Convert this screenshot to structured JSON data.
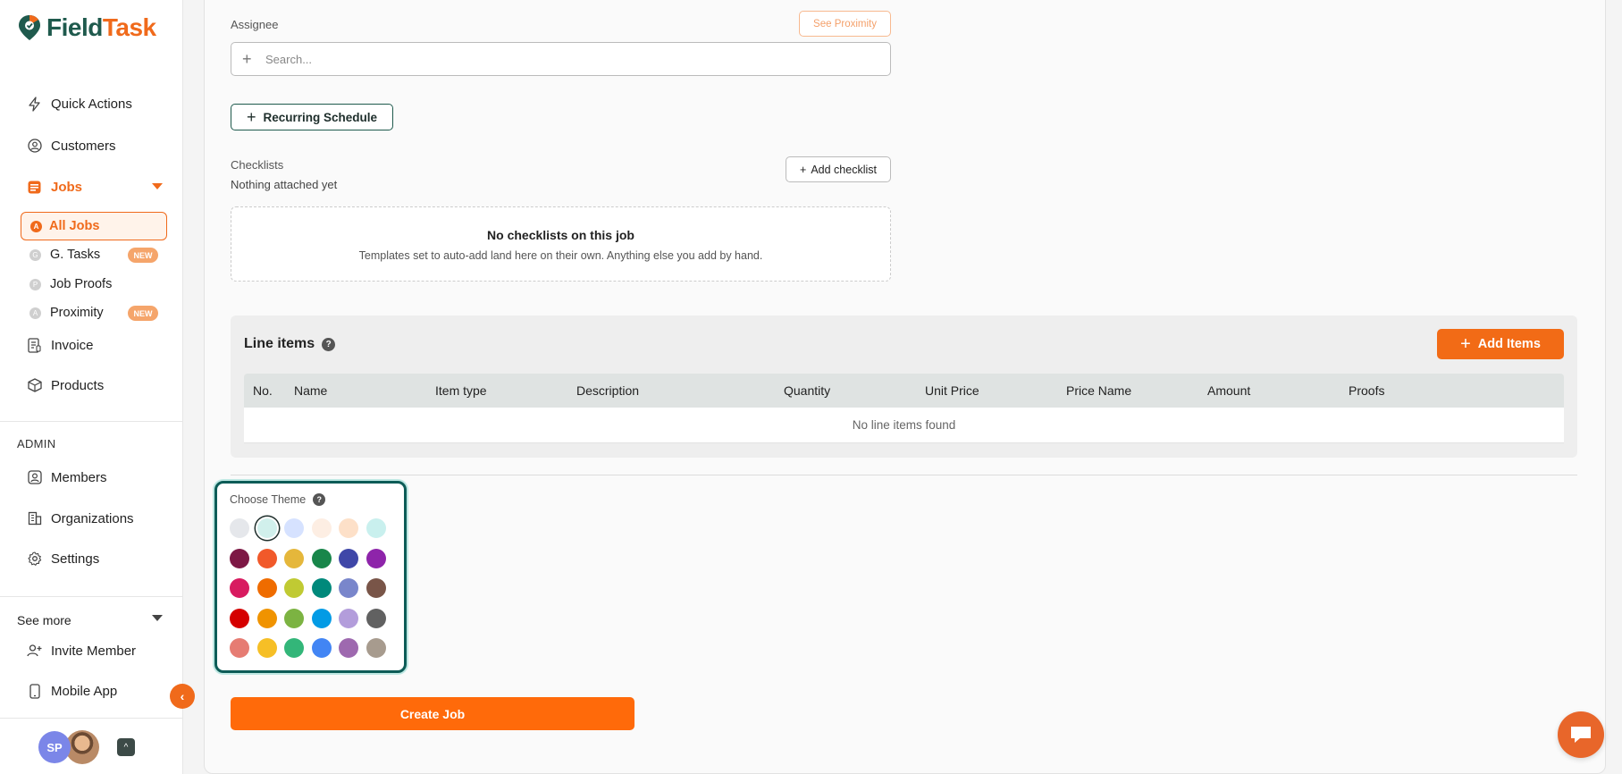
{
  "brand": {
    "name_part1": "Field",
    "name_part2": "Task"
  },
  "sidebar": {
    "items": [
      {
        "label": "Quick Actions",
        "icon": "lightning-icon"
      },
      {
        "label": "Customers",
        "icon": "user-circle-icon"
      },
      {
        "label": "Jobs",
        "icon": "jobs-icon"
      },
      {
        "label": "Invoice",
        "icon": "invoice-icon"
      },
      {
        "label": "Products",
        "icon": "box-icon"
      }
    ],
    "jobs_sub": [
      {
        "label": "All Jobs",
        "letter": "A"
      },
      {
        "label": "G. Tasks",
        "letter": "G",
        "badge": "NEW"
      },
      {
        "label": "Job Proofs",
        "letter": "P"
      },
      {
        "label": "Proximity",
        "letter": "A",
        "badge": "NEW"
      }
    ],
    "admin_label": "ADMIN",
    "admin_items": [
      {
        "label": "Members",
        "icon": "member-icon"
      },
      {
        "label": "Organizations",
        "icon": "building-icon"
      },
      {
        "label": "Settings",
        "icon": "gear-icon"
      }
    ],
    "see_more": "See more",
    "more_items": [
      {
        "label": "Invite Member",
        "icon": "user-plus-icon"
      },
      {
        "label": "Mobile App",
        "icon": "phone-icon"
      }
    ],
    "user_initials": "SP",
    "collapse_glyph": "‹",
    "user_menu_glyph": "^"
  },
  "form": {
    "assignee_label": "Assignee",
    "see_proximity": "See Proximity",
    "search_placeholder": "Search...",
    "recurring_label": "Recurring Schedule",
    "checklists_label": "Checklists",
    "checklists_sub": "Nothing attached yet",
    "add_checklist": "Add checklist",
    "no_checklists_title": "No checklists on this job",
    "no_checklists_desc": "Templates set to auto-add land here on their own. Anything else you add by hand.",
    "line_items_title": "Line items",
    "add_items": "Add Items",
    "columns": [
      "No.",
      "Name",
      "Item type",
      "Description",
      "Quantity",
      "Unit Price",
      "Price Name",
      "Amount",
      "Proofs"
    ],
    "no_line_items": "No line items found",
    "theme_label": "Choose Theme",
    "create_job": "Create Job"
  },
  "theme_colors": [
    [
      "#e5e7eb",
      "#d1f0ec",
      "#d6e2ff",
      "#fdeee3",
      "#fde0c8",
      "#c9f0ee"
    ],
    [
      "#7d1845",
      "#f1592a",
      "#e5b73b",
      "#18864a",
      "#3f47a8",
      "#8e24aa"
    ],
    [
      "#d81b60",
      "#ef6c00",
      "#c0ca33",
      "#00897b",
      "#7986cb",
      "#795548"
    ],
    [
      "#d50000",
      "#f09300",
      "#7cb342",
      "#039be5",
      "#b39ddb",
      "#616161"
    ],
    [
      "#e67c73",
      "#f6bf26",
      "#33b679",
      "#4285f4",
      "#9e69af",
      "#a79b8e"
    ]
  ],
  "selected_theme": {
    "row": 0,
    "col": 1
  },
  "accent": "#f06a1b",
  "primary_dark": "#1f5a4d"
}
